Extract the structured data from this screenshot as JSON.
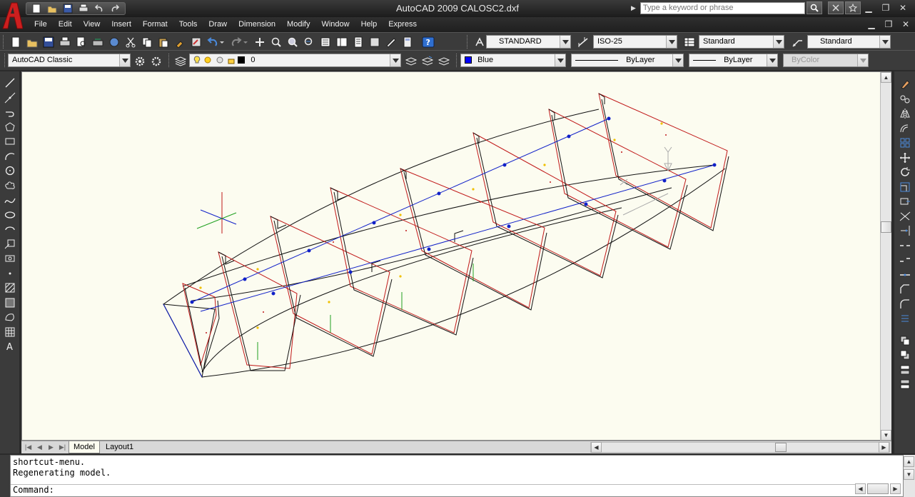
{
  "title": {
    "app": "AutoCAD 2009",
    "file": "CALOSC2.dxf"
  },
  "search": {
    "placeholder": "Type a keyword or phrase"
  },
  "menu": [
    "File",
    "Edit",
    "View",
    "Insert",
    "Format",
    "Tools",
    "Draw",
    "Dimension",
    "Modify",
    "Window",
    "Help",
    "Express"
  ],
  "styles": {
    "text_style": "STANDARD",
    "dim_style": "ISO-25",
    "table_style": "Standard",
    "multileader_style": "Standard"
  },
  "workspace": "AutoCAD Classic",
  "layer": {
    "current": "0"
  },
  "properties": {
    "color": "Blue",
    "color_hex": "#0000ff",
    "linetype": "ByLayer",
    "lineweight": "ByLayer",
    "plot_style": "ByColor"
  },
  "tabs": [
    "Model",
    "Layout1"
  ],
  "command": {
    "history": [
      "shortcut-menu.",
      "Regenerating model."
    ],
    "prompt": "Command:"
  },
  "colors": {
    "accent_red": "#cc1f1f",
    "drawing_bg": "#fcfcf0",
    "line_red": "#c01818",
    "line_blue": "#1020c8",
    "line_black": "#111111"
  }
}
